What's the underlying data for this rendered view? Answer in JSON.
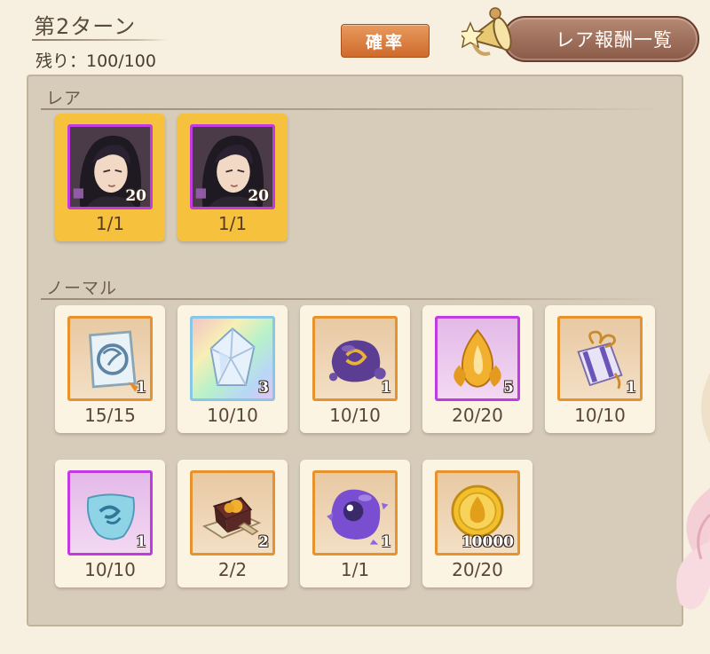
{
  "header": {
    "turn_title": "第2ターン",
    "remaining": "残り：100/100",
    "probability_button": "確率",
    "rare_list_button": "レア報酬一覧"
  },
  "sections": {
    "rare_label": "レア",
    "normal_label": "ノーマル"
  },
  "rare_items": [
    {
      "icon": "character-portrait-icon",
      "count": "20",
      "fraction": "1/1"
    },
    {
      "icon": "character-portrait-icon",
      "count": "20",
      "fraction": "1/1"
    }
  ],
  "normal_items": [
    {
      "icon": "scroll-icon",
      "count": "1",
      "fraction": "15/15"
    },
    {
      "icon": "crystal-icon",
      "count": "3",
      "fraction": "10/10"
    },
    {
      "icon": "purple-slime-icon",
      "count": "1",
      "fraction": "10/10"
    },
    {
      "icon": "golden-flame-icon",
      "count": "5",
      "fraction": "20/20"
    },
    {
      "icon": "gift-box-icon",
      "count": "1",
      "fraction": "10/10"
    },
    {
      "icon": "blue-cloth-icon",
      "count": "1",
      "fraction": "10/10"
    },
    {
      "icon": "treasure-chest-icon",
      "count": "2",
      "fraction": "2/2"
    },
    {
      "icon": "purple-orb-icon",
      "count": "1",
      "fraction": "1/1"
    },
    {
      "icon": "gold-coin-icon",
      "count": "10000",
      "fraction": "20/20"
    }
  ],
  "colors": {
    "rare_card": "#f6c13c",
    "panel": "#d7ccba",
    "orange_frame": "#e7922c",
    "purple_frame": "#c13be1"
  }
}
